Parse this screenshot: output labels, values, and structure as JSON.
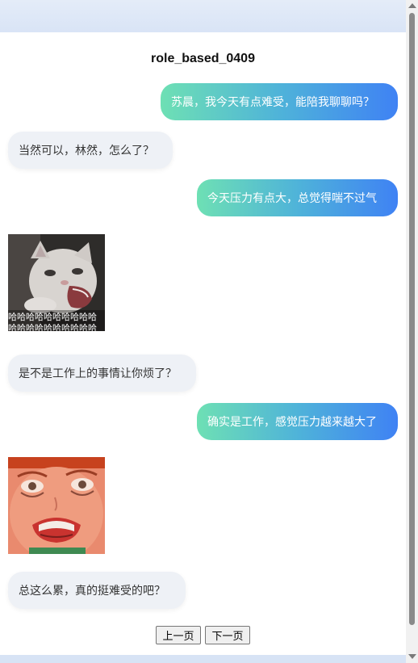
{
  "page": {
    "title": "role_based_0409"
  },
  "messages": [
    {
      "role": "user",
      "text": "苏晨，我今天有点难受，能陪我聊聊吗？"
    },
    {
      "role": "assistant",
      "text": "当然可以，林然，怎么了？"
    },
    {
      "role": "user",
      "text": "今天压力有点大，总觉得喘不过气"
    },
    {
      "role": "assistant",
      "sticker": "laughing-cat-sticker",
      "caption": "哈哈哈哈哈哈哈哈哈哈"
    },
    {
      "role": "assistant",
      "text": "是不是工作上的事情让你烦了？"
    },
    {
      "role": "user",
      "text": "确实是工作，感觉压力越来越大了"
    },
    {
      "role": "assistant",
      "sticker": "crying-doll-face-sticker"
    },
    {
      "role": "assistant",
      "text": "总这么累，真的挺难受的吧？"
    }
  ],
  "pagination": {
    "prev_label": "上一页",
    "next_label": "下一页"
  },
  "colors": {
    "user_bubble_gradient": [
      "#6ee0b4",
      "#3f82f4"
    ],
    "assistant_bubble": "#eef1f6",
    "page_background": "#dbe6f7"
  }
}
